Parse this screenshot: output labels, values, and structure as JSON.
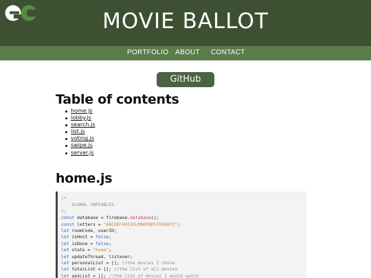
{
  "header": {
    "logo_text": "ec",
    "title": "MOVIE BALLOT",
    "colors": {
      "header_bg": "#3d5132",
      "nav_bg": "#5c7c4a",
      "button_bg": "#4b6340"
    }
  },
  "nav": {
    "items": [
      {
        "label": "PORTFOLIO"
      },
      {
        "label": "ABOUT"
      },
      {
        "label": "CONTACT"
      }
    ]
  },
  "main": {
    "github_label": "GitHub",
    "toc_heading": "Table of contents",
    "toc_items": [
      "home.js",
      "lobby.js",
      "search.js",
      "list.js",
      "voting.js",
      "swipe.js",
      "server.js"
    ],
    "section_heading": "home.js"
  },
  "code": {
    "lines": [
      [
        {
          "t": "/*",
          "c": "cm"
        }
      ],
      [
        {
          "t": "    GLOBAL VARIABLES",
          "c": "cm"
        }
      ],
      [
        {
          "t": "*/",
          "c": "cm"
        }
      ],
      [
        {
          "t": "const",
          "c": "kw"
        },
        {
          "t": " database = firebase.",
          "c": ""
        },
        {
          "t": "database",
          "c": "prop"
        },
        {
          "t": "();",
          "c": ""
        }
      ],
      [
        {
          "t": "const",
          "c": "kw"
        },
        {
          "t": " letters = ",
          "c": ""
        },
        {
          "t": "\"ABCDEFGHIJKLMNOPQRSTUVWXYZ\"",
          "c": "str"
        },
        {
          "t": ";",
          "c": ""
        }
      ],
      [
        {
          "t": "let",
          "c": "kw"
        },
        {
          "t": " roomCode, userID;",
          "c": ""
        }
      ],
      [
        {
          "t": "let",
          "c": "kw"
        },
        {
          "t": " isHost = ",
          "c": ""
        },
        {
          "t": "false",
          "c": "kw"
        },
        {
          "t": ";",
          "c": ""
        }
      ],
      [
        {
          "t": "let",
          "c": "kw"
        },
        {
          "t": " isDone = ",
          "c": ""
        },
        {
          "t": "false",
          "c": "kw"
        },
        {
          "t": ";",
          "c": ""
        }
      ],
      [
        {
          "t": "let",
          "c": "kw"
        },
        {
          "t": " state = ",
          "c": ""
        },
        {
          "t": "\"home\"",
          "c": "str"
        },
        {
          "t": ";",
          "c": ""
        }
      ],
      [
        {
          "t": "let",
          "c": "kw"
        },
        {
          "t": " updateThread, listener;",
          "c": ""
        }
      ],
      [
        {
          "t": "let",
          "c": "kw"
        },
        {
          "t": " personalList = []; ",
          "c": ""
        },
        {
          "t": "//the movies I chose",
          "c": "cm"
        }
      ],
      [
        {
          "t": "let",
          "c": "kw"
        },
        {
          "t": " totalList = []; ",
          "c": ""
        },
        {
          "t": "//the list of all movies",
          "c": "cm"
        }
      ],
      [
        {
          "t": "let",
          "c": "kw"
        },
        {
          "t": " yesList = []; ",
          "c": ""
        },
        {
          "t": "//the list of movies I would watch",
          "c": "cm"
        }
      ]
    ]
  }
}
